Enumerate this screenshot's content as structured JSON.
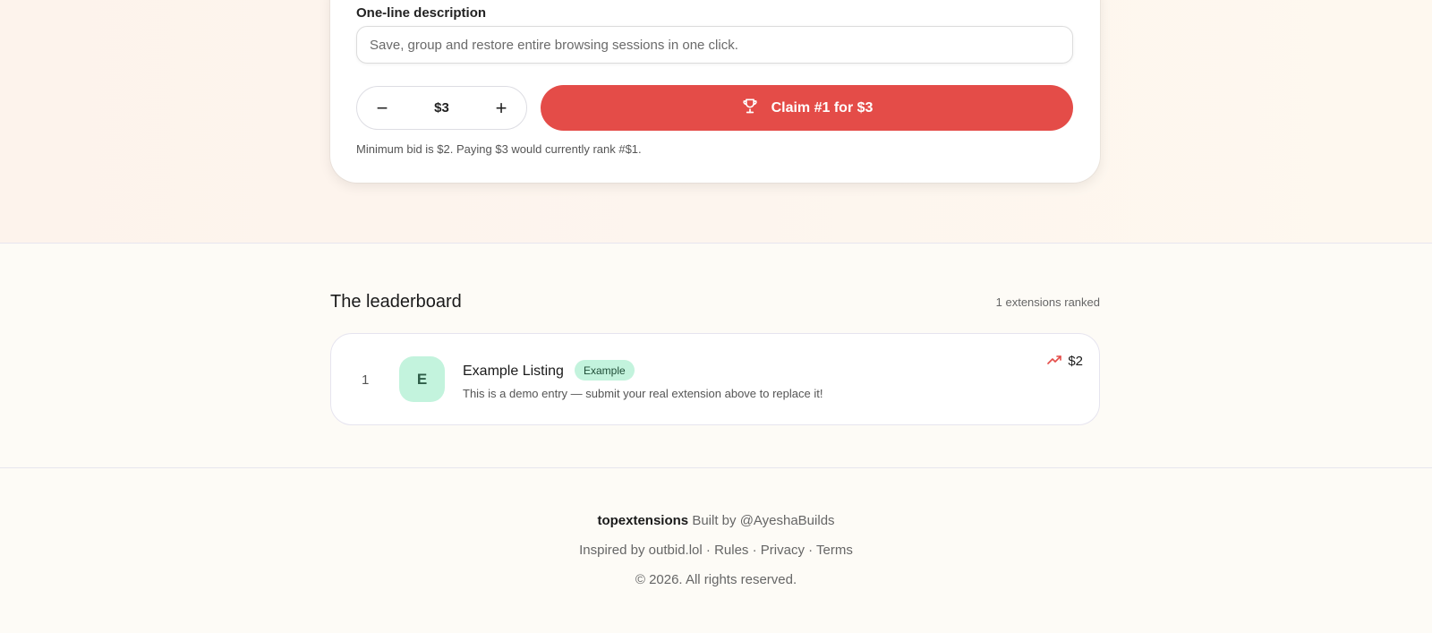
{
  "form": {
    "description_label": "One-line description",
    "description_value": "Save, group and restore entire browsing sessions in one click.",
    "bid_value": "$3",
    "decrement_symbol": "−",
    "increment_symbol": "+",
    "claim_label": "Claim #1 for $3",
    "claim_icon": "trophy-icon",
    "hint": "Minimum bid is $2. Paying $3 would currently rank #$1."
  },
  "leaderboard": {
    "title": "The leaderboard",
    "count_text": "1 extensions ranked",
    "entries": [
      {
        "rank": "1",
        "avatar_letter": "E",
        "name": "Example Listing",
        "badge": "Example",
        "description": "This is a demo entry — submit your real extension above to replace it!",
        "price": "$2",
        "price_icon": "trending-up-icon"
      }
    ]
  },
  "footer": {
    "brand": "topextensions",
    "built_by_text": "Built by",
    "author": "@AyeshaBuilds",
    "inspired_text": "Inspired by outbid.lol",
    "separator": "·",
    "links": [
      "Rules",
      "Privacy",
      "Terms"
    ],
    "copyright": "© 2026. All rights reserved."
  },
  "colors": {
    "accent": "#e44c48",
    "badge_bg": "#c3f3dd",
    "trend_icon": "#e44c48"
  }
}
